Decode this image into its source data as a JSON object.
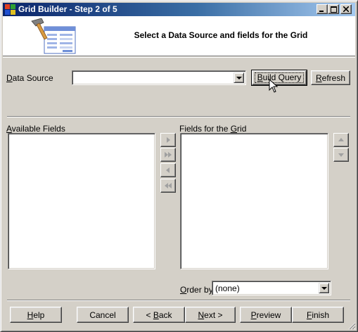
{
  "window": {
    "title": "Grid Builder - Step 2 of 5",
    "controls": {
      "minimize": "_",
      "maximize": "□",
      "close": "✕"
    }
  },
  "header": {
    "heading": "Select a Data Source and fields for the Grid",
    "icon": "grid-builder-wizard-icon"
  },
  "data_source": {
    "label_mnemonic": "D",
    "label_rest": "ata Source",
    "value": "",
    "build_query": {
      "mnemonic": "B",
      "rest": "uild Query"
    },
    "refresh": {
      "mnemonic": "R",
      "rest": "efresh"
    }
  },
  "available_fields": {
    "label_mnemonic": "A",
    "label_rest": "vailable Fields",
    "items": []
  },
  "grid_fields": {
    "label_before": "Fields for the ",
    "label_mnemonic": "G",
    "label_after": "rid",
    "items": []
  },
  "move_buttons": [
    "move-right-icon",
    "move-all-right-icon",
    "move-left-icon",
    "move-all-left-icon"
  ],
  "order_buttons": [
    "move-up-icon",
    "move-down-icon"
  ],
  "order_by": {
    "label_mnemonic": "O",
    "label_rest": "rder by",
    "value": "(none)"
  },
  "footer": {
    "help": {
      "mnemonic": "H",
      "rest": "elp"
    },
    "cancel": {
      "label": "Cancel"
    },
    "back": {
      "prefix": "< ",
      "mnemonic": "B",
      "rest": "ack"
    },
    "next": {
      "mnemonic": "N",
      "rest": "ext >"
    },
    "preview": {
      "mnemonic": "P",
      "rest": "review"
    },
    "finish": {
      "mnemonic": "F",
      "rest": "inish"
    }
  }
}
